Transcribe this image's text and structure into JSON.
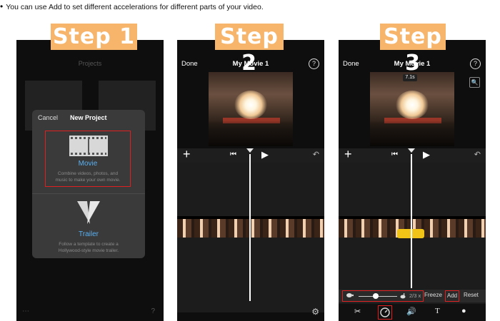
{
  "intro": {
    "bullet": "•",
    "text": "You can use Add to set different accelerations for different parts of your video."
  },
  "steps": [
    "Step 1",
    "Step 2",
    "Step 3"
  ],
  "phone1": {
    "title": "Projects",
    "dialog": {
      "cancel": "Cancel",
      "title": "New Project",
      "movie": {
        "label": "Movie",
        "desc_line1": "Combine videos, photos, and",
        "desc_line2": "music to make your own movie."
      },
      "trailer": {
        "label": "Trailer",
        "desc_line1": "Follow a template to create a",
        "desc_line2": "Hollywood-style movie trailer."
      }
    },
    "bottom_left": "⋯",
    "bottom_right": "?"
  },
  "phone2": {
    "done": "Done",
    "title": "My Movie 1",
    "help": "?",
    "plus": "+",
    "skip": "⏮",
    "play": "▶",
    "undo": "↶",
    "gear": "⚙"
  },
  "phone3": {
    "done": "Done",
    "title": "My Movie 1",
    "help": "?",
    "duration": "7.1s",
    "zoom": "🔍",
    "plus": "+",
    "skip": "⏮",
    "play": "▶",
    "undo": "↶",
    "speed": {
      "ratio": "2/3 x",
      "freeze": "Freeze",
      "add": "Add",
      "reset": "Reset"
    },
    "tools": {
      "scissors": "✂",
      "volume": "🔊",
      "text": "T",
      "filter": "●"
    }
  }
}
